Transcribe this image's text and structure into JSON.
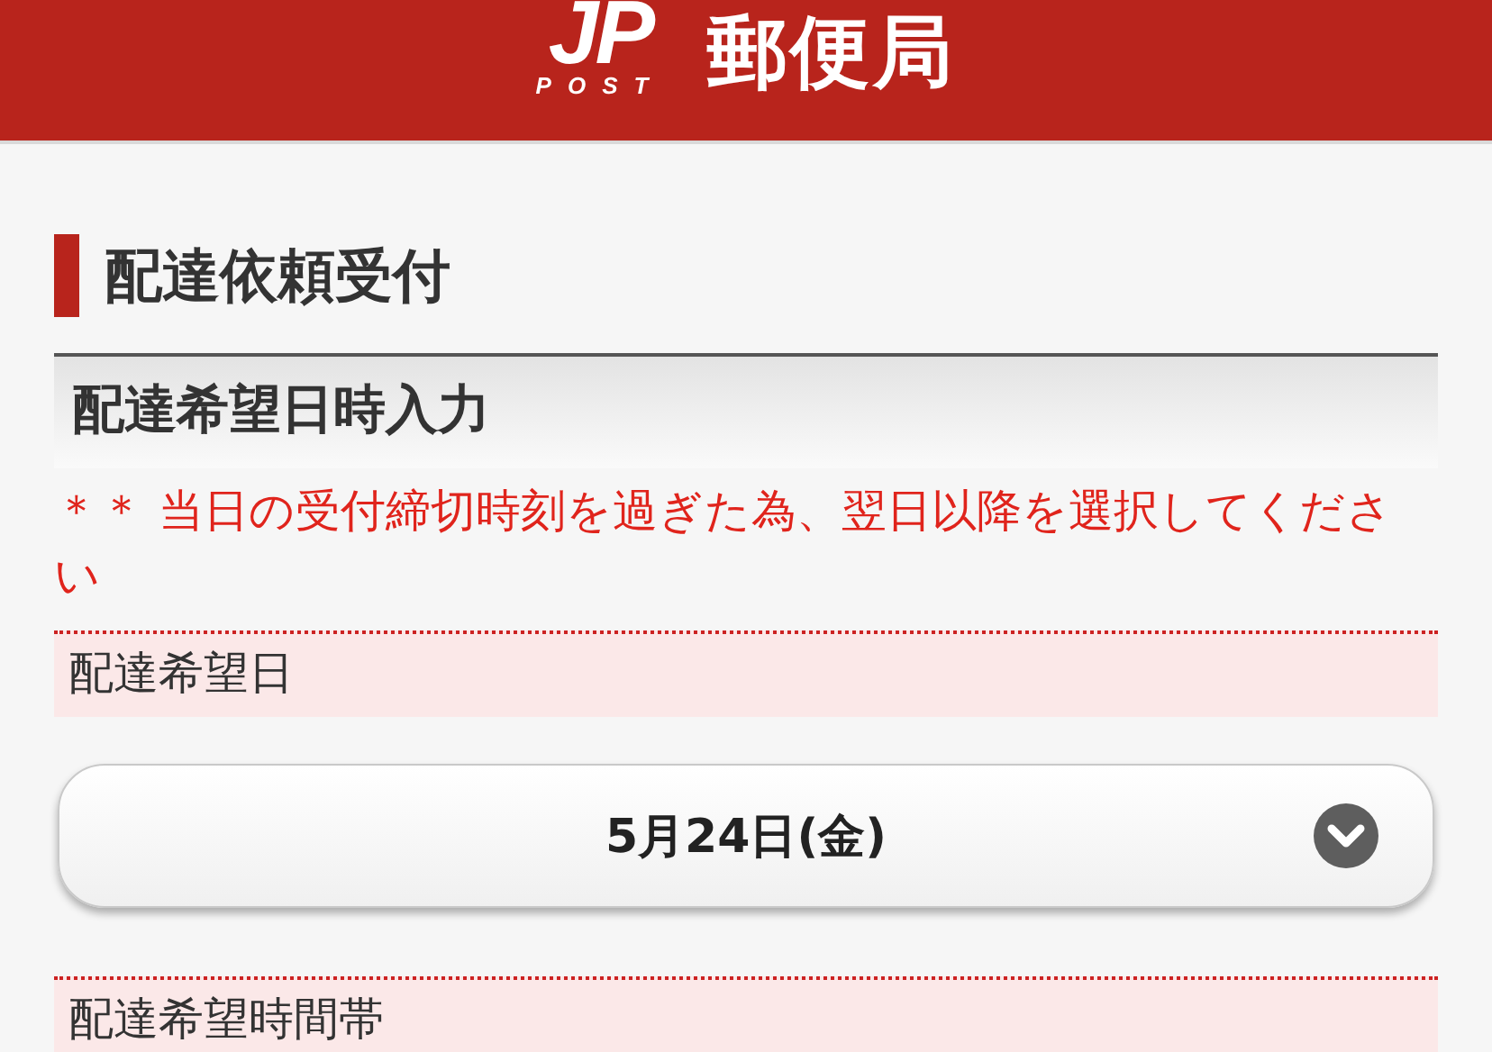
{
  "header": {
    "logo_mark": "JP",
    "logo_subtext": "POST",
    "title": "郵便局"
  },
  "page_title": "配達依頼受付",
  "section_title": "配達希望日時入力",
  "notice": "＊＊ 当日の受付締切時刻を過ぎた為、翌日以降を選択してください",
  "fields": [
    {
      "label": "配達希望日",
      "value": "5月24日(金)"
    },
    {
      "label": "配達希望時間帯"
    }
  ]
}
